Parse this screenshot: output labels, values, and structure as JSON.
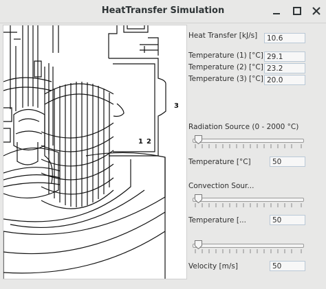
{
  "window": {
    "title": "HeatTransfer Simulation"
  },
  "diagram": {
    "label_1": "1",
    "label_2": "2",
    "label_3": "3"
  },
  "panel": {
    "heat_transfer_label": "Heat Transfer [kJ/s]",
    "heat_transfer_value": "10.6",
    "temp1_label": "Temperature (1) [°C]",
    "temp1_value": "29.1",
    "temp2_label": "Temperature (2) [°C]",
    "temp2_value": "23.2",
    "temp3_label": "Temperature (3) [°C]",
    "temp3_value": "20.0",
    "radiation_label": "Radiation Source (0 - 2000 °C)",
    "radiation_temp_label": "Temperature [°C]",
    "radiation_temp_value": "50",
    "convection_label": "Convection Sour...",
    "convection_temp_label": "Temperature [...",
    "convection_temp_value": "50",
    "velocity_label": "Velocity [m/s]",
    "velocity_value": "50"
  },
  "sliders": {
    "radiation_fraction": 0.0,
    "convection_fraction": 0.0,
    "velocity_fraction": 0.0
  }
}
